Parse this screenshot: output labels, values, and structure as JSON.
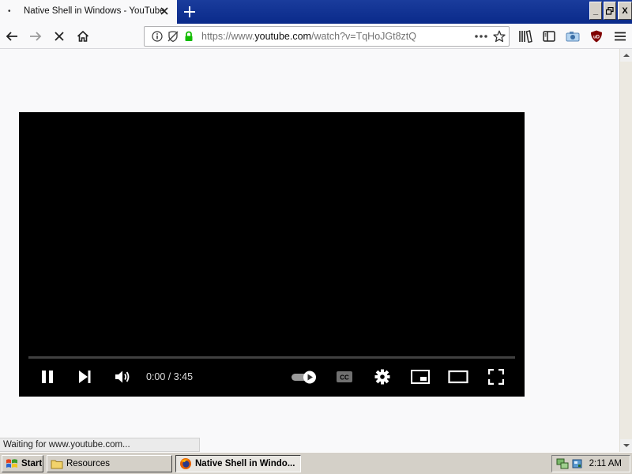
{
  "browser": {
    "tab": {
      "bullet": "•",
      "title": "Native Shell in Windows - YouTube"
    },
    "url": {
      "scheme": "https://www.",
      "host": "youtube.com",
      "path": "/watch?v=TqHoJGt8ztQ"
    },
    "status_text": "Waiting for www.youtube.com..."
  },
  "window_controls": {
    "minimize": "_",
    "restore": "🗗",
    "close": "X"
  },
  "player": {
    "timecode": "0:00 / 3:45",
    "progress_fraction": 0
  },
  "taskbar": {
    "start_label": "Start",
    "items": [
      {
        "label": "Resources",
        "icon": "folder-icon"
      },
      {
        "label": "Native Shell in Windo...",
        "icon": "firefox-icon"
      }
    ],
    "clock": "2:11 AM"
  },
  "colors": {
    "titlebar": "#0a2a8a",
    "player_bg": "#000000",
    "lock_green": "#12bc00"
  }
}
